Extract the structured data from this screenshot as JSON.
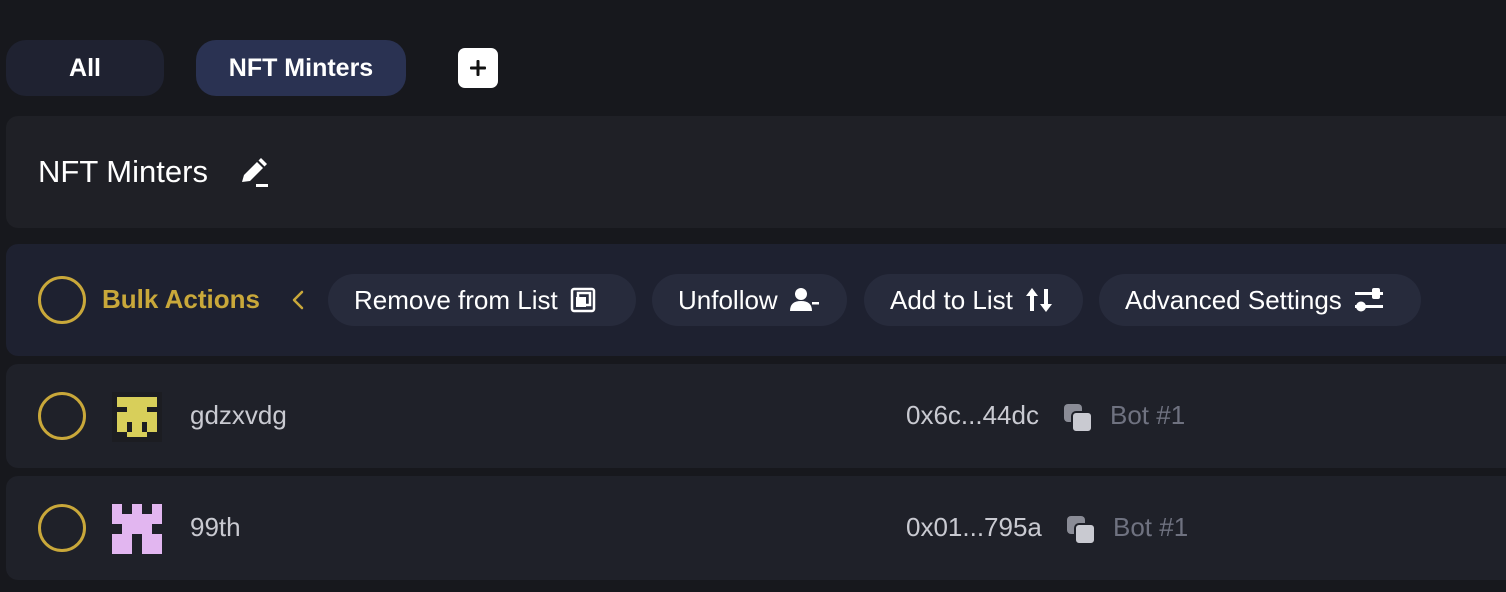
{
  "tabs": [
    {
      "label": "All",
      "active": false
    },
    {
      "label": "NFT Minters",
      "active": true
    }
  ],
  "add_tab_icon": "plus-icon",
  "list": {
    "title": "NFT Minters",
    "edit_icon": "pencil-edit-icon"
  },
  "bulk": {
    "label": "Bulk Actions",
    "collapse_icon": "chevron-left-icon",
    "actions": [
      {
        "label": "Remove from List",
        "icon": "remove-from-list-icon"
      },
      {
        "label": "Unfollow",
        "icon": "user-minus-icon"
      },
      {
        "label": "Add to List",
        "icon": "sort-arrows-icon"
      },
      {
        "label": "Advanced Settings",
        "icon": "sliders-icon"
      }
    ]
  },
  "rows": [
    {
      "username": "gdzxvdg",
      "address": "0x6c...44dc",
      "bot": "Bot #1",
      "avatar_color": "#d8cf5a"
    },
    {
      "username": "99th",
      "address": "0x01...795a",
      "bot": "Bot #1",
      "avatar_color": "#e2b6f0"
    }
  ],
  "colors": {
    "accent": "#c9a83a",
    "background": "#17181d",
    "panel": "#1f2026",
    "pill": "#272b3c",
    "active_tab": "#2a3252"
  }
}
